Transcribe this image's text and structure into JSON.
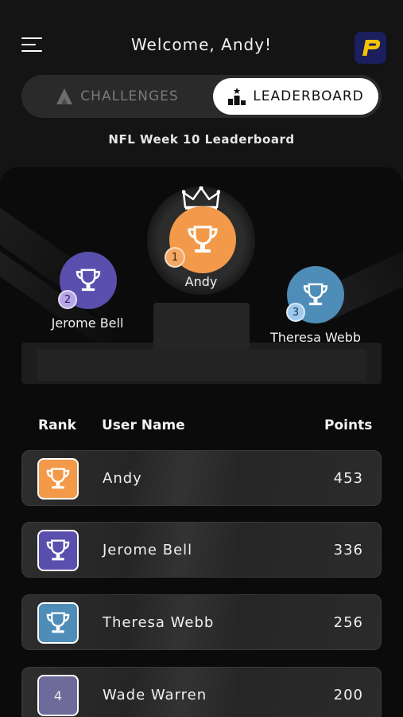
{
  "header": {
    "welcome": "Welcome, Andy!",
    "logo_letter": "P"
  },
  "tabs": [
    {
      "label": "CHALLENGES",
      "active": false
    },
    {
      "label": "LEADERBOARD",
      "active": true
    }
  ],
  "subtitle": "NFL Week 10 Leaderboard",
  "podium": [
    {
      "rank": "1",
      "name": "Andy",
      "color": "#f29a4a"
    },
    {
      "rank": "2",
      "name": "Jerome Bell",
      "color": "#5b4fae"
    },
    {
      "rank": "3",
      "name": "Theresa Webb",
      "color": "#4f8db9"
    }
  ],
  "table": {
    "headers": {
      "rank": "Rank",
      "user": "User Name",
      "points": "Points"
    },
    "rows": [
      {
        "rank": "1",
        "name": "Andy",
        "points": "453",
        "color": "#f29a4a",
        "trophy": true
      },
      {
        "rank": "2",
        "name": "Jerome Bell",
        "points": "336",
        "color": "#5b4fae",
        "trophy": true
      },
      {
        "rank": "3",
        "name": "Theresa Webb",
        "points": "256",
        "color": "#4f8db9",
        "trophy": true
      },
      {
        "rank": "4",
        "name": "Wade Warren",
        "points": "200",
        "color": "#6e6a9a",
        "trophy": false
      }
    ]
  },
  "colors": {
    "background": "#141414",
    "gold": "#f29a4a",
    "purple": "#5b4fae",
    "blue": "#4f8db9",
    "logo_bg": "#1b1f5e",
    "logo_fg": "#f5c400"
  },
  "icons": [
    "menu-icon",
    "brand-logo-icon",
    "challenges-icon",
    "leaderboard-icon",
    "trophy-icon",
    "crown-icon"
  ]
}
